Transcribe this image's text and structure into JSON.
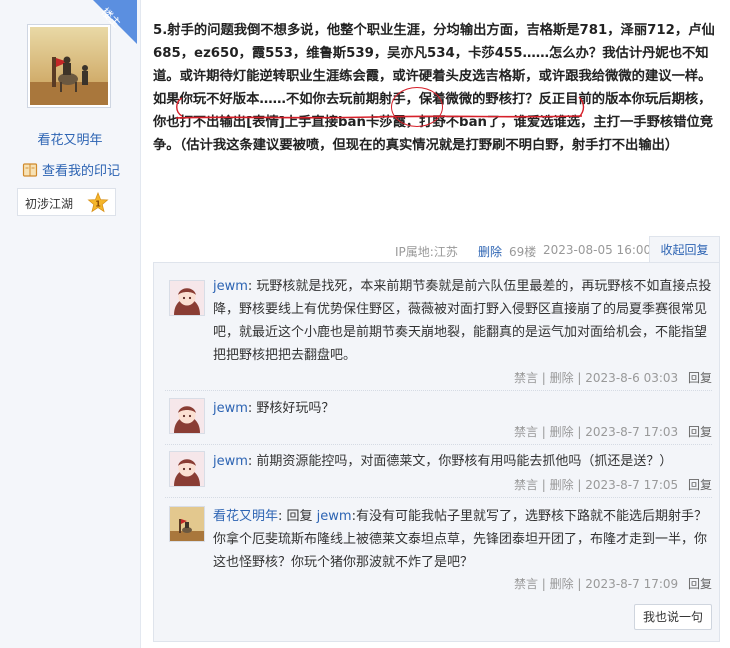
{
  "user": {
    "name": "看花又明年",
    "imprint_label": "查看我的印记",
    "level_name": "初涉江湖",
    "level_num": "1"
  },
  "floor_badge": "楼主",
  "post": {
    "text": "5.射手的问题我倒不想多说，他整个职业生涯，分均输出方面，吉格斯是781，泽丽712，卢仙685，ez650，霞553，维鲁斯539，吴亦凡534，卡莎455……怎么办？我估计丹妮也不知道。或许期待灯能逆转职业生涯练会霞，或许硬着头皮选吉格斯，或许跟我给微微的建议一样。如果你玩不好版本……不如你去玩前期射手，保着微微的野核打？反正目前的版本你玩后期核，你也打不出输出[表情]上手直接ban卡莎霞，打野不ban了，谁爱选谁选，主打一手野核错位竞争。（估计我这条建议要被喷，但现在的真实情况就是打野刷不明白野，射手打不出输出）"
  },
  "meta": {
    "ip": "IP属地:江苏",
    "delete": "删除",
    "floor": "69楼",
    "time": "2023-08-05 16:00",
    "collapse": "收起回复"
  },
  "comments": [
    {
      "user": "jewm",
      "reply_prefix": "",
      "reply_target": "",
      "text": "玩野核就是找死，本来前期节奏就是前六队伍里最差的，再玩野核不如直接点投降，野核要线上有优势保住野区，薇薇被对面打野入侵野区直接崩了的局夏季赛很常见吧，就最近这个小鹿也是前期节奏天崩地裂，能翻真的是运气加对面给机会，不能指望把把野核把把去翻盘吧。",
      "actions": "禁言 | 删除 | 2023-8-6 03:03",
      "reply": "回复"
    },
    {
      "user": "jewm",
      "reply_prefix": "",
      "reply_target": "",
      "text": "野核好玩吗？",
      "actions": "禁言 | 删除 | 2023-8-7 17:03",
      "reply": "回复"
    },
    {
      "user": "jewm",
      "reply_prefix": "",
      "reply_target": "",
      "text": "前期资源能控吗，对面德莱文，你野核有用吗能去抓他吗（抓还是送？）",
      "actions": "禁言 | 删除 | 2023-8-7 17:05",
      "reply": "回复"
    },
    {
      "user": "看花又明年",
      "reply_prefix": "回复 ",
      "reply_target": "jewm",
      "text": ":有没有可能我帖子里就写了，选野核下路就不能选后期射手？你拿个厄斐琉斯布隆线上被德莱文泰坦点草，先锋团泰坦开团了，布隆才走到一半，你这也怪野核？你玩个猪你那波就不炸了是吧？",
      "actions": "禁言 | 删除 | 2023-8-7 17:09",
      "reply": "回复"
    }
  ],
  "say_button": "我也说一句",
  "icons": {
    "imprint": "book-icon",
    "level": "star-badge-icon"
  },
  "colors": {
    "link": "#2d64b3",
    "annotation": "#d6202a",
    "badge": "#5b8fe0"
  }
}
